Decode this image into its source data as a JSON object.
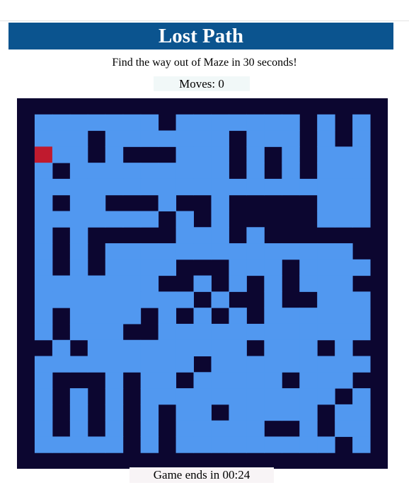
{
  "header": {
    "title": "Lost Path"
  },
  "instructions": "Find the way out of Maze in 30 seconds!",
  "status": {
    "moves_label": "Moves: 0",
    "timer_label": "Game ends in 00:24"
  },
  "colors": {
    "path": "#5198f0",
    "wall": "#0c0630",
    "player": "#c01a2e",
    "title_bar": "#0b548f"
  },
  "maze": {
    "cols": 21,
    "rows": 21,
    "player": [
      1,
      3
    ],
    "grid": [
      "#####################",
      "#.......#.......#.#.#",
      "#...#.......#...#.#.#",
      "#P..#.###...#.#.#...#",
      "#.#.........#.#.#...#",
      "#...................#",
      "#.#..###.##.#####...#",
      "#.......#.#.#####...#",
      "#.#.#####...#.#######",
      "#.#.#..............##",
      "#.#.#....###...#....#",
      "#.......##.#.#.#...##",
      "#.........#.##.##...#",
      "#.#....#.#.#.#......#",
      "#.#...##............#",
      "##.#.........#...#.##",
      "#.........#.........#",
      "#.###.#..#.....#...##",
      "#.#.#.#...........#.#",
      "#.#.#.#.#..#.....#..#",
      "#.#.#.#.#.....##.#..#",
      "#.....#.#.........#.#",
      "#####################"
    ]
  }
}
